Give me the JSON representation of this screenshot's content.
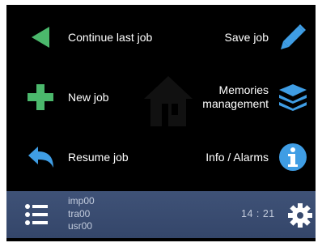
{
  "menu": {
    "continue_last_job": "Continue last job",
    "new_job": "New job",
    "resume_job": "Resume job",
    "save_job": "Save job",
    "memories_management_line1": "Memories",
    "memories_management_line2": "management",
    "info_alarms": "Info / Alarms"
  },
  "status_bar": {
    "lines": [
      "imp00",
      "tra00",
      "usr00"
    ],
    "time": "14 : 21"
  },
  "icons": {
    "continue": "play-left-triangle-icon",
    "new": "plus-icon",
    "resume": "back-arrow-icon",
    "save": "pencil-icon",
    "memories": "layers-icon",
    "info": "info-icon",
    "list": "list-icon",
    "settings": "gear-icon",
    "home": "home-watermark-icon"
  },
  "colors": {
    "green": "#4bb86c",
    "blue": "#3f9de4",
    "status_bar": "#3a4c70"
  }
}
